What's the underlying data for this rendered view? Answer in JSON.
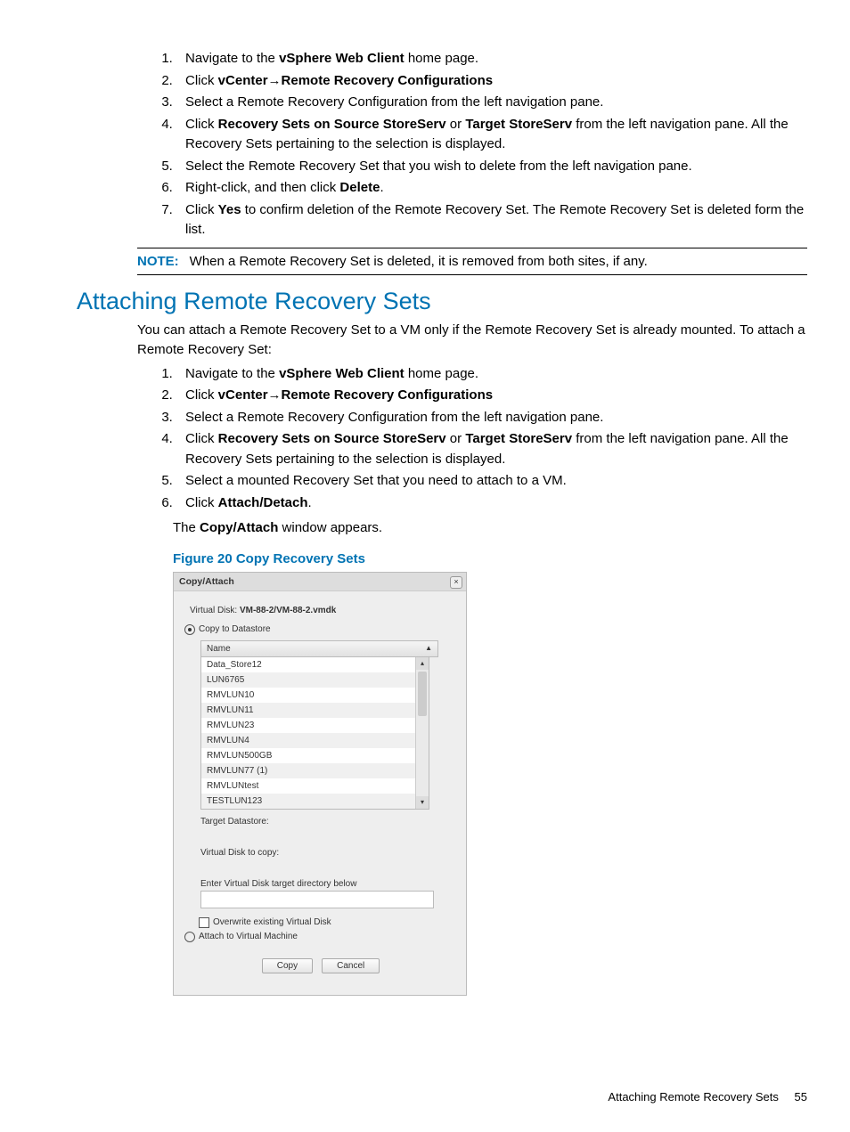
{
  "list1": {
    "i1a": "Navigate to the ",
    "i1b": "vSphere Web Client",
    "i1c": " home page.",
    "i2a": "Click ",
    "i2b": "vCenter",
    "i2arrow": "→",
    "i2c": "Remote Recovery Configurations",
    "i3": "Select a Remote Recovery Configuration from the left navigation pane.",
    "i4a": "Click ",
    "i4b": "Recovery Sets on Source StoreServ",
    "i4c": " or ",
    "i4d": "Target StoreServ",
    "i4e": " from the left navigation pane. All the Recovery Sets pertaining to the selection is displayed.",
    "i5": "Select the Remote Recovery Set that you wish to delete from the left navigation pane.",
    "i6a": "Right-click, and then click ",
    "i6b": "Delete",
    "i6c": ".",
    "i7a": "Click ",
    "i7b": "Yes",
    "i7c": " to confirm deletion of the Remote Recovery Set. The Remote Recovery Set is deleted form the list."
  },
  "note": {
    "label": "NOTE:",
    "text": "When a Remote Recovery Set is deleted, it is removed from both sites, if any."
  },
  "heading": "Attaching Remote Recovery Sets",
  "intro": "You can attach a Remote Recovery Set to a VM only if the Remote Recovery Set is already mounted. To attach a Remote Recovery Set:",
  "list2": {
    "i1a": "Navigate to the ",
    "i1b": "vSphere Web Client",
    "i1c": " home page.",
    "i2a": "Click ",
    "i2b": "vCenter",
    "i2arrow": "→",
    "i2c": "Remote Recovery Configurations",
    "i3": "Select a Remote Recovery Configuration from the left navigation pane.",
    "i4a": "Click ",
    "i4b": "Recovery Sets on Source StoreServ",
    "i4c": " or ",
    "i4d": "Target StoreServ",
    "i4e": " from the left navigation pane. All the Recovery Sets pertaining to the selection is displayed.",
    "i5": "Select a mounted Recovery Set that you need to attach to a VM.",
    "i6a": "Click ",
    "i6b": "Attach/Detach",
    "i6c": "."
  },
  "after6a": "The ",
  "after6b": "Copy/Attach",
  "after6c": " window appears.",
  "figcap": "Figure 20 Copy Recovery Sets",
  "dialog": {
    "title": "Copy/Attach",
    "close": "×",
    "vdisk_label": "Virtual Disk: ",
    "vdisk_value": "VM-88-2/VM-88-2.vmdk",
    "radio_copy": "Copy to Datastore",
    "col_name": "Name",
    "sort_glyph": "▲",
    "rows": [
      "Data_Store12",
      "LUN6765",
      "RMVLUN10",
      "RMVLUN11",
      "RMVLUN23",
      "RMVLUN4",
      "RMVLUN500GB",
      "RMVLUN77 (1)",
      "RMVLUNtest",
      "TESTLUN123"
    ],
    "target_ds": "Target Datastore:",
    "vdisk_copy": "Virtual Disk to copy:",
    "enter_dir": "Enter Virtual Disk target directory below",
    "cb_overwrite": "Overwrite existing Virtual Disk",
    "radio_attach": "Attach to Virtual Machine",
    "btn_copy": "Copy",
    "btn_cancel": "Cancel",
    "scroll_up": "▴",
    "scroll_down": "▾"
  },
  "footer": {
    "text": "Attaching Remote Recovery Sets",
    "page": "55"
  }
}
